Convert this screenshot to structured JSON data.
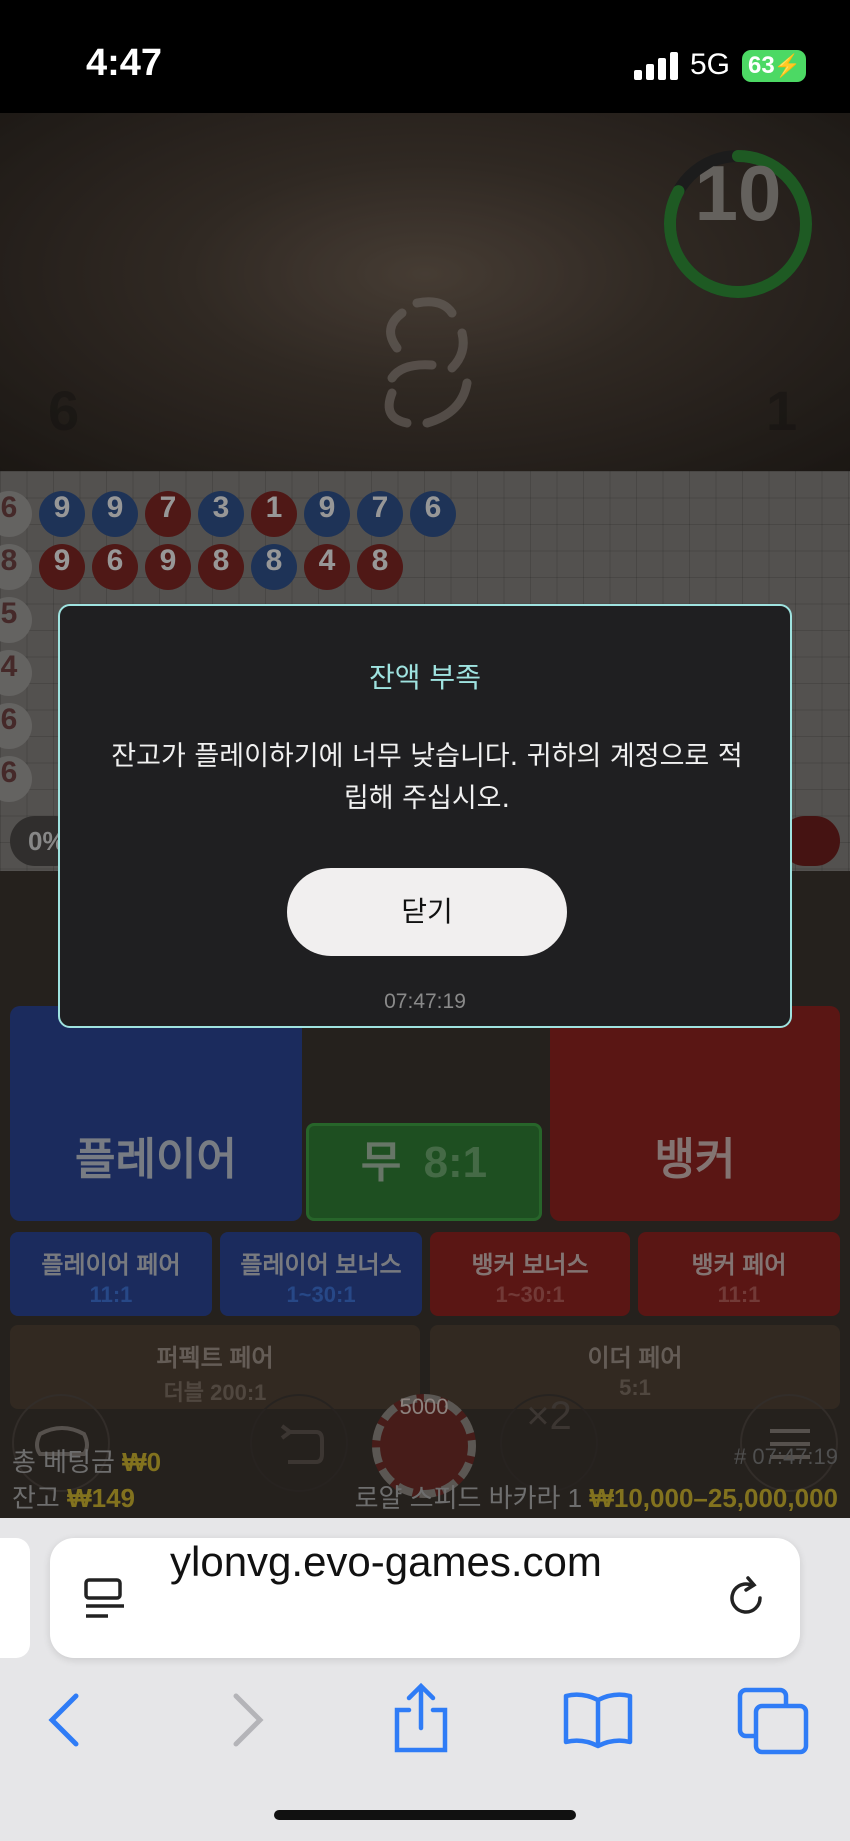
{
  "status_bar": {
    "time": "4:47",
    "network": "5G",
    "battery": "63"
  },
  "video": {
    "timer": "10",
    "left_score": "6",
    "right_score": "1",
    "timer_progress": 0.83
  },
  "roadmap": {
    "beads": [
      {
        "v": "6",
        "c": "w"
      },
      {
        "v": "9",
        "c": "b"
      },
      {
        "v": "9",
        "c": "b"
      },
      {
        "v": "7",
        "c": "r"
      },
      {
        "v": "3",
        "c": "b"
      },
      {
        "v": "1",
        "c": "r"
      },
      {
        "v": "9",
        "c": "b"
      },
      {
        "v": "7",
        "c": "b"
      },
      {
        "v": "6",
        "c": "b"
      },
      {
        "v": "8",
        "c": "w"
      },
      {
        "v": "9",
        "c": "r"
      },
      {
        "v": "6",
        "c": "r"
      },
      {
        "v": "9",
        "c": "r"
      },
      {
        "v": "8",
        "c": "r"
      },
      {
        "v": "8",
        "c": "b"
      },
      {
        "v": "4",
        "c": "r"
      },
      {
        "v": "8",
        "c": "r"
      },
      {
        "v": "5",
        "c": "w"
      },
      {
        "v": "4",
        "c": "w"
      },
      {
        "v": "6",
        "c": "w"
      },
      {
        "v": "6",
        "c": "w"
      }
    ],
    "percent_label": "0%"
  },
  "bets": {
    "player": "플레이어",
    "tie": "무",
    "tie_odds": "8:1",
    "banker": "뱅커",
    "player_pair": {
      "label": "플레이어 페어",
      "odds": "11:1"
    },
    "player_bonus": {
      "label": "플레이어 보너스",
      "odds": "1~30:1"
    },
    "banker_bonus": {
      "label": "뱅커 보너스",
      "odds": "1~30:1"
    },
    "banker_pair": {
      "label": "뱅커 페어",
      "odds": "11:1"
    },
    "perfect_pair": {
      "label": "퍼펙트 페어",
      "odds": "더블 200:1"
    },
    "either_pair": {
      "label": "이더 페어",
      "odds": "5:1"
    }
  },
  "controls": {
    "chip_value": "5000",
    "double_label": "×2"
  },
  "info": {
    "total_bet_label": "총 베팅금",
    "total_bet_value": "₩0",
    "balance_label": "잔고",
    "balance_value": "₩149",
    "game_id": "# 07:47:19",
    "table_name": "로얄 스피드 바카라 1",
    "limits": "₩10,000–25,000,000"
  },
  "modal": {
    "title": "잔액 부족",
    "message": "잔고가 플레이하기에 너무 낮습니다. 귀하의 계정으로 적립해 주십시오.",
    "button": "닫기",
    "timestamp": "07:47:19"
  },
  "browser": {
    "url": "ylonvg.evo-games.com"
  },
  "colors": {
    "accent": "#9fe3e0",
    "player": "#2a4f9a",
    "banker": "#9a2422",
    "tie": "#2f7a33"
  }
}
